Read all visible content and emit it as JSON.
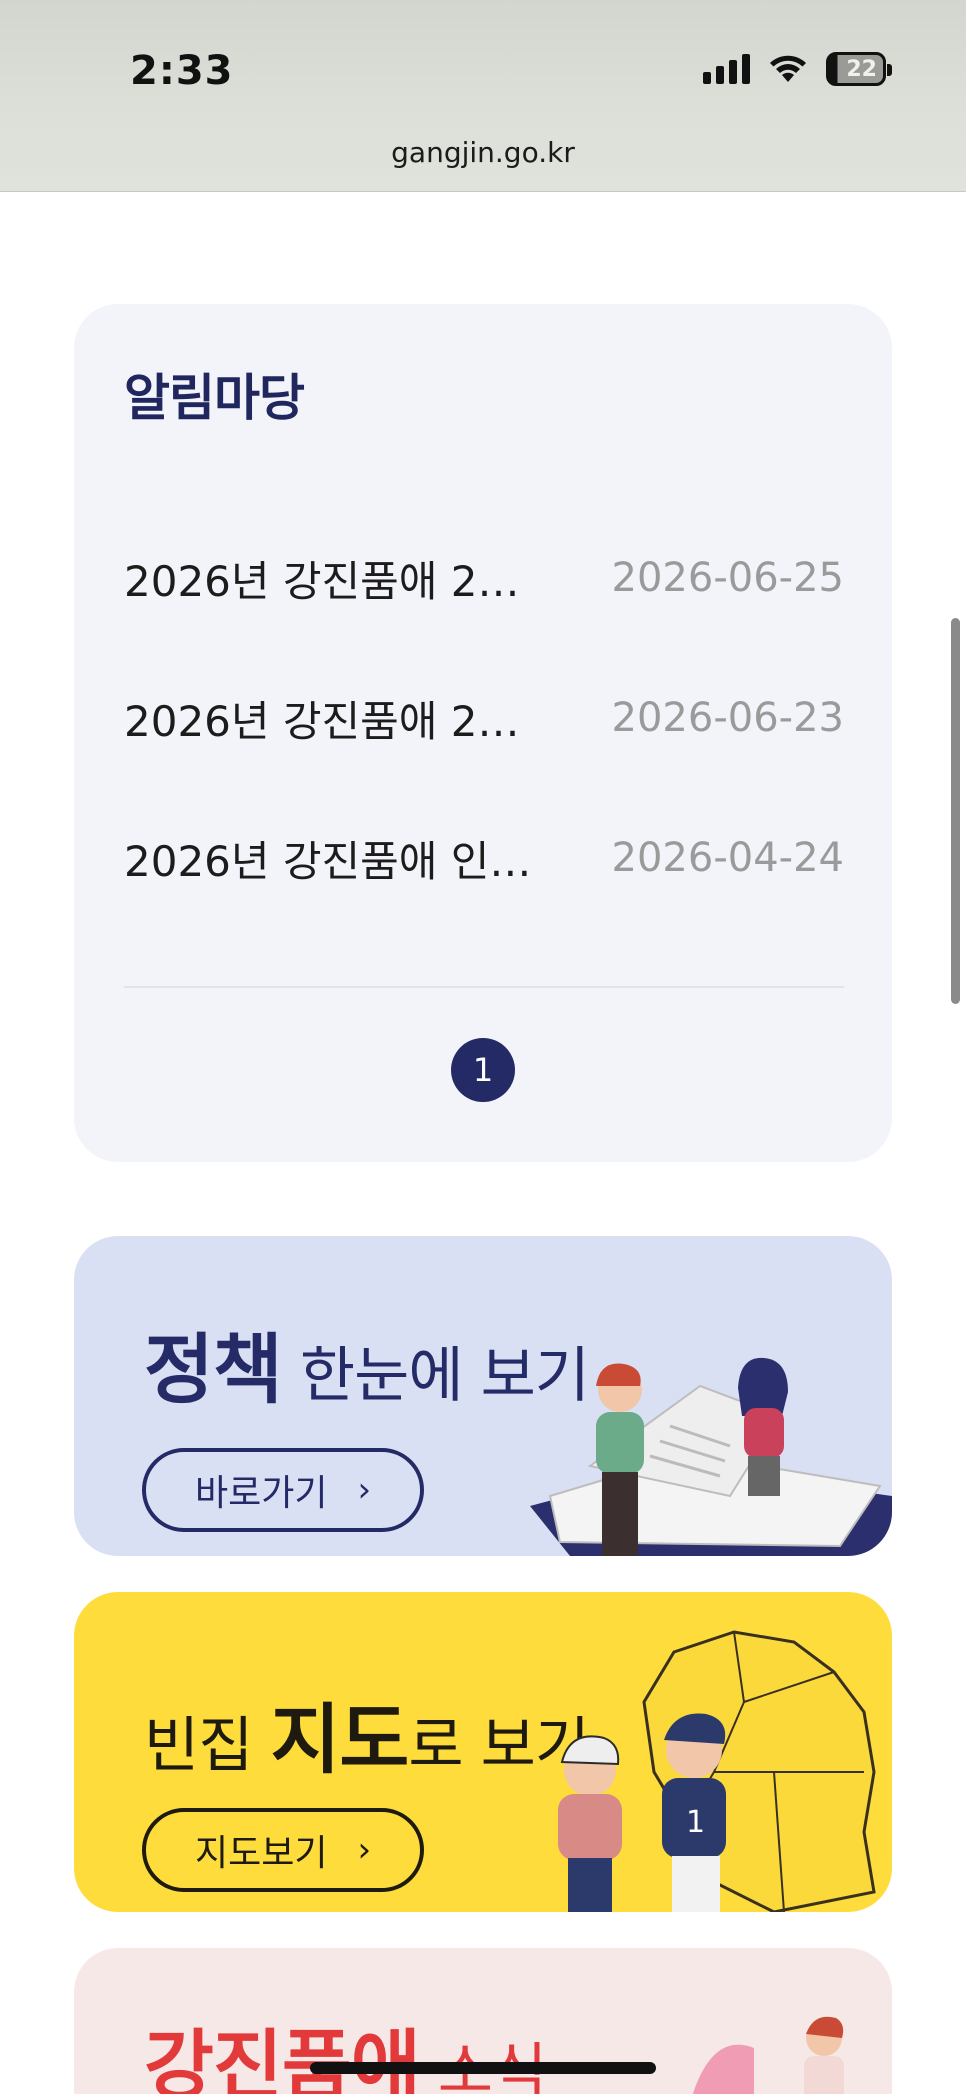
{
  "status_bar": {
    "time": "2:33",
    "battery": "22",
    "url": "gangjin.go.kr"
  },
  "notice": {
    "title": "알림마당",
    "items": [
      {
        "title": "2026년 강진품애 2…",
        "date": "2026-06-25"
      },
      {
        "title": "2026년 강진품애 2…",
        "date": "2026-06-23"
      },
      {
        "title": "2026년 강진품애 인…",
        "date": "2026-04-24"
      }
    ],
    "current_page": "1"
  },
  "banners": {
    "policy": {
      "title_bold": "정책",
      "title_rest": " 한눈에 보기",
      "button_label": "바로가기",
      "bg_color": "#d9e0f4"
    },
    "map": {
      "title_pre": "빈집 ",
      "title_bold": "지도",
      "title_rest": "로 보기",
      "button_label": "지도보기",
      "bg_color": "#fddc3b"
    },
    "news": {
      "title_bold": "강진품애",
      "title_rest": " 소식",
      "bg_color": "#f6e8e7"
    }
  },
  "colors": {
    "navy": "#232a66",
    "date_gray": "#9a9a9a",
    "news_red": "#e23a3a"
  },
  "icons": {
    "chevron": "chevron-right-icon",
    "signal": "cellular-signal-icon",
    "wifi": "wifi-icon",
    "battery": "battery-icon"
  }
}
